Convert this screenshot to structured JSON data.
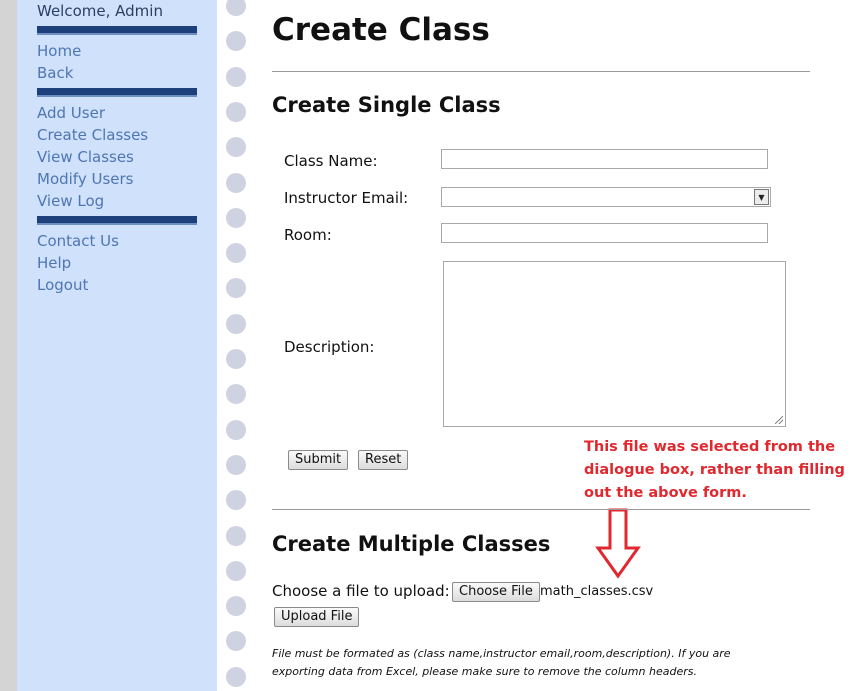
{
  "sidebar": {
    "welcome": "Welcome, Admin",
    "group1": [
      "Home",
      "Back"
    ],
    "group2": [
      "Add User",
      "Create Classes",
      "View Classes",
      "Modify Users",
      "View Log"
    ],
    "group3": [
      "Contact Us",
      "Help",
      "Logout"
    ]
  },
  "page": {
    "title": "Create Class"
  },
  "single": {
    "heading": "Create Single Class",
    "class_name_label": "Class Name:",
    "class_name_value": "",
    "instructor_email_label": "Instructor Email:",
    "instructor_email_value": "",
    "room_label": "Room:",
    "room_value": "",
    "description_label": "Description:",
    "submit_label": "Submit",
    "reset_label": "Reset"
  },
  "annotation": {
    "text": "This file was selected from the dialogue box, rather than filling out the above form.",
    "color": "#e0282e"
  },
  "multiple": {
    "heading": "Create Multiple Classes",
    "choose_label": "Choose a file to upload:",
    "choose_button": "Choose File",
    "file_name": "math_classes.csv",
    "upload_button": "Upload File",
    "note": "File must be formated as (class name,instructor email,room,description). If you are exporting data from Excel, please make sure to remove the column headers."
  },
  "colors": {
    "sidebar_bg": "#cfe1fb",
    "nav_link": "#4f76b3",
    "divider_bar": "#1d3f7c"
  }
}
